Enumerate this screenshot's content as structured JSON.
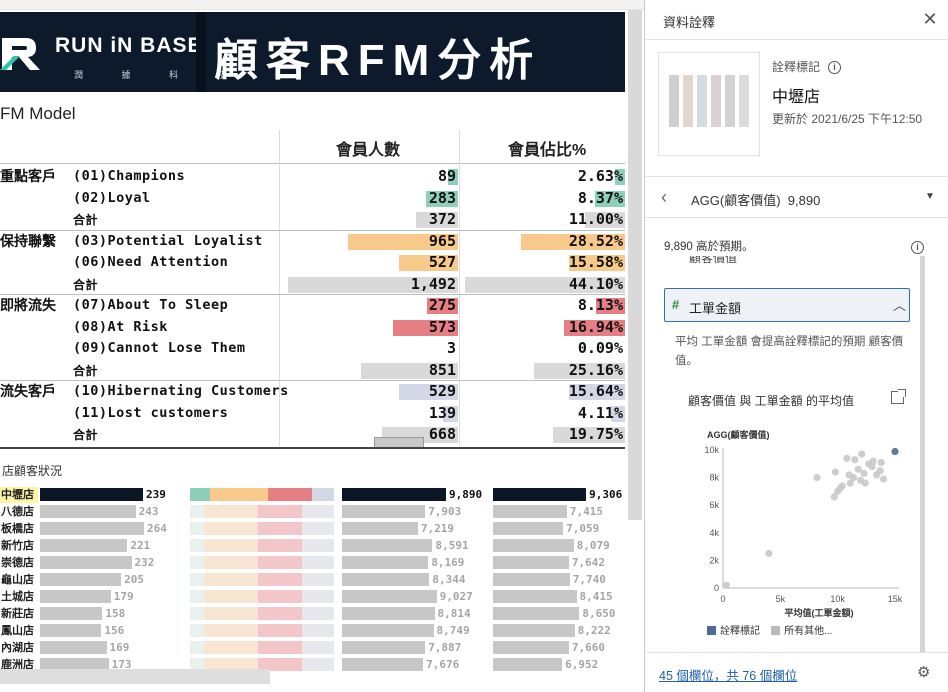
{
  "banner": {
    "brand": "RUN iN BASE",
    "brand_sub": "潤 據 科 技",
    "title": "顧客RFM分析"
  },
  "model_label": "FM Model",
  "rfm": {
    "headers": {
      "members": "會員人數",
      "share": "會員佔比%"
    },
    "rows": [
      {
        "group": "重點客戶",
        "segment": "(01)Champions",
        "members": "89",
        "share": "2.63%",
        "m_frac": 0.06,
        "s_frac": 0.06,
        "color": "#8ecfb9"
      },
      {
        "group": "",
        "segment": "(02)Loyal",
        "members": "283",
        "share": "8.37%",
        "m_frac": 0.19,
        "s_frac": 0.19,
        "color": "#8ecfb9"
      },
      {
        "group": "",
        "segment": "合計",
        "members": "372",
        "share": "11.00%",
        "m_frac": 0.25,
        "s_frac": 0.25,
        "color": "#d9d9d9",
        "total": true
      },
      {
        "group": "保持聯繫",
        "segment": "(03)Potential Loyalist",
        "members": "965",
        "share": "28.52%",
        "m_frac": 0.65,
        "s_frac": 0.65,
        "color": "#f7ca8c"
      },
      {
        "group": "",
        "segment": "(06)Need Attention",
        "members": "527",
        "share": "15.58%",
        "m_frac": 0.35,
        "s_frac": 0.35,
        "color": "#f7ca8c"
      },
      {
        "group": "",
        "segment": "合計",
        "members": "1,492",
        "share": "44.10%",
        "m_frac": 1.0,
        "s_frac": 1.0,
        "color": "#d9d9d9",
        "total": true
      },
      {
        "group": "即將流失",
        "segment": "(07)About To Sleep",
        "members": "275",
        "share": "8.13%",
        "m_frac": 0.18,
        "s_frac": 0.18,
        "color": "#e57f84"
      },
      {
        "group": "",
        "segment": "(08)At Risk",
        "members": "573",
        "share": "16.94%",
        "m_frac": 0.38,
        "s_frac": 0.38,
        "color": "#e57f84"
      },
      {
        "group": "",
        "segment": "(09)Cannot Lose Them",
        "members": "3",
        "share": "0.09%",
        "m_frac": 0.0,
        "s_frac": 0.0,
        "color": "#e57f84"
      },
      {
        "group": "",
        "segment": "合計",
        "members": "851",
        "share": "25.16%",
        "m_frac": 0.57,
        "s_frac": 0.57,
        "color": "#d9d9d9",
        "total": true
      },
      {
        "group": "流失客戶",
        "segment": "(10)Hibernating Customers",
        "members": "529",
        "share": "15.64%",
        "m_frac": 0.35,
        "s_frac": 0.35,
        "color": "#d3d8e6"
      },
      {
        "group": "",
        "segment": "(11)Lost customers",
        "members": "139",
        "share": "4.11%",
        "m_frac": 0.09,
        "s_frac": 0.09,
        "color": "#d3d8e6"
      },
      {
        "group": "",
        "segment": "合計",
        "members": "668",
        "share": "19.75%",
        "m_frac": 0.45,
        "s_frac": 0.45,
        "color": "#d9d9d9",
        "total": true
      }
    ]
  },
  "stores": {
    "title": "店顧客狀況",
    "rows": [
      {
        "name": "中壢店",
        "count": "239",
        "count_frac": 0.99,
        "value": "9,890",
        "value_frac": 1.0,
        "orders": "9,306",
        "orders_frac": 0.97,
        "selected": true
      },
      {
        "name": "八德店",
        "count": "243",
        "count_frac": 0.92,
        "value": "7,903",
        "value_frac": 0.8,
        "orders": "7,415",
        "orders_frac": 0.77
      },
      {
        "name": "板橋店",
        "count": "264",
        "count_frac": 1.0,
        "value": "7,219",
        "value_frac": 0.73,
        "orders": "7,059",
        "orders_frac": 0.73
      },
      {
        "name": "新竹店",
        "count": "221",
        "count_frac": 0.84,
        "value": "8,591",
        "value_frac": 0.87,
        "orders": "8,079",
        "orders_frac": 0.84
      },
      {
        "name": "崇德店",
        "count": "232",
        "count_frac": 0.88,
        "value": "8,169",
        "value_frac": 0.83,
        "orders": "7,642",
        "orders_frac": 0.79
      },
      {
        "name": "龜山店",
        "count": "205",
        "count_frac": 0.78,
        "value": "8,344",
        "value_frac": 0.84,
        "orders": "7,740",
        "orders_frac": 0.8
      },
      {
        "name": "土城店",
        "count": "179",
        "count_frac": 0.68,
        "value": "9,027",
        "value_frac": 0.91,
        "orders": "8,415",
        "orders_frac": 0.87
      },
      {
        "name": "新莊店",
        "count": "158",
        "count_frac": 0.6,
        "value": "8,814",
        "value_frac": 0.89,
        "orders": "8,650",
        "orders_frac": 0.9
      },
      {
        "name": "鳳山店",
        "count": "156",
        "count_frac": 0.59,
        "value": "8,749",
        "value_frac": 0.88,
        "orders": "8,222",
        "orders_frac": 0.85
      },
      {
        "name": "內湖店",
        "count": "169",
        "count_frac": 0.64,
        "value": "7,887",
        "value_frac": 0.8,
        "orders": "7,660",
        "orders_frac": 0.79
      },
      {
        "name": "鹿洲店",
        "count": "173",
        "count_frac": 0.66,
        "value": "7,676",
        "value_frac": 0.78,
        "orders": "6,952",
        "orders_frac": 0.72
      }
    ]
  },
  "pane": {
    "title": "資料詮釋",
    "close_icon": "close-icon",
    "mark_label": "詮釋標記",
    "mark_name": "中壢店",
    "updated": "更新於 2021/6/25 下午12:50",
    "agg_label": "AGG(顧客價值)",
    "agg_value": "9,890",
    "prediction": "9,890 高於預期。",
    "clipped_item": "顧客價值",
    "field_name": "工單金額",
    "field_desc": "平均 工單金額 會提高詮釋標記的預期 顧客價值。",
    "chart_title": "顧客價值 與 工單金額 的平均值",
    "legend_mark": "詮釋標記",
    "legend_other": "所有其他...",
    "footer": "45 個欄位，共 76 個欄位"
  },
  "chart_data": {
    "type": "scatter",
    "title": "顧客價值 與 工單金額 的平均值",
    "ylabel": "AGG(顧客價值)",
    "xlabel": "平均值(工單金額)",
    "xlim": [
      0,
      15000
    ],
    "ylim": [
      0,
      10000
    ],
    "xticks": [
      "0",
      "5k",
      "10k",
      "15k"
    ],
    "yticks": [
      "0",
      "2k",
      "4k",
      "6k",
      "8k",
      "10k"
    ],
    "series": [
      {
        "name": "詮釋標記",
        "color": "#4e6a96",
        "points": [
          [
            15000,
            9890
          ]
        ]
      },
      {
        "name": "所有其他...",
        "color": "#c9c9c9",
        "points": [
          [
            300,
            200
          ],
          [
            4000,
            2500
          ],
          [
            8200,
            8000
          ],
          [
            9700,
            6600
          ],
          [
            10000,
            7000
          ],
          [
            10200,
            7200
          ],
          [
            10400,
            7400
          ],
          [
            9800,
            8400
          ],
          [
            11000,
            8200
          ],
          [
            11400,
            8000
          ],
          [
            11800,
            8600
          ],
          [
            12000,
            7800
          ],
          [
            12300,
            8300
          ],
          [
            12700,
            9000
          ],
          [
            13000,
            8800
          ],
          [
            13400,
            8200
          ],
          [
            13700,
            8500
          ],
          [
            14000,
            7900
          ],
          [
            10800,
            9400
          ],
          [
            12100,
            9700
          ],
          [
            11500,
            9300
          ],
          [
            13100,
            9200
          ],
          [
            12400,
            7600
          ],
          [
            11100,
            7600
          ],
          [
            13800,
            9100
          ]
        ]
      }
    ],
    "grid": false,
    "legend": "bottom"
  }
}
